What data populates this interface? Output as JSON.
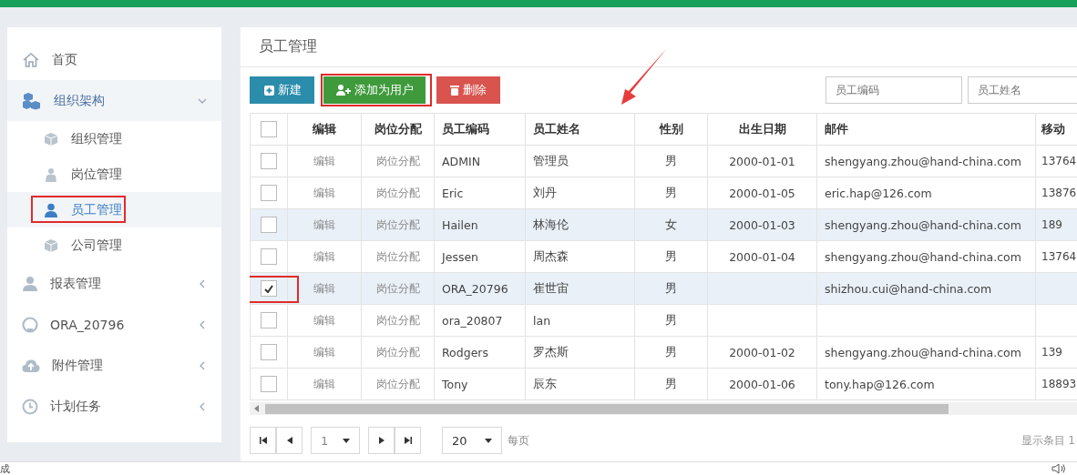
{
  "sidebar": {
    "items": [
      {
        "label": "首页",
        "kind": "link"
      },
      {
        "label": "组织架构",
        "kind": "group",
        "expanded": true,
        "children": [
          {
            "label": "组织管理",
            "selected": false
          },
          {
            "label": "岗位管理",
            "selected": false
          },
          {
            "label": "员工管理",
            "selected": true
          },
          {
            "label": "公司管理",
            "selected": false
          }
        ]
      },
      {
        "label": "报表管理",
        "kind": "group",
        "expanded": false
      },
      {
        "label": "ORA_20796",
        "kind": "group",
        "expanded": false
      },
      {
        "label": "附件管理",
        "kind": "group",
        "expanded": false
      },
      {
        "label": "计划任务",
        "kind": "group",
        "expanded": false
      }
    ]
  },
  "page_title": "员工管理",
  "toolbar": {
    "buttons": [
      {
        "label": "新建",
        "kind": "new"
      },
      {
        "label": "添加为用户",
        "kind": "add-user"
      },
      {
        "label": "删除",
        "kind": "delete"
      }
    ],
    "filters": [
      {
        "placeholder": "员工编码"
      },
      {
        "placeholder": "员工姓名"
      }
    ]
  },
  "table": {
    "select_all_checked": false,
    "columns": [
      "编辑",
      "岗位分配",
      "员工编码",
      "员工姓名",
      "性别",
      "出生日期",
      "邮件",
      "移动"
    ],
    "rows": [
      {
        "checked": false,
        "highlighted": false,
        "edit": "编辑",
        "assign": "岗位分配",
        "code": "ADMIN",
        "name": "管理员",
        "gender": "男",
        "birth": "2000-01-01",
        "email": "shengyang.zhou@hand-china.com",
        "phone": "13764"
      },
      {
        "checked": false,
        "highlighted": false,
        "edit": "编辑",
        "assign": "岗位分配",
        "code": "Eric",
        "name": "刘丹",
        "gender": "男",
        "birth": "2000-01-05",
        "email": "eric.hap@126.com",
        "phone": "13876"
      },
      {
        "checked": false,
        "highlighted": true,
        "edit": "编辑",
        "assign": "岗位分配",
        "code": "Hailen",
        "name": "林海伦",
        "gender": "女",
        "birth": "2000-01-03",
        "email": "shengyang.zhou@hand-china.com",
        "phone": "189"
      },
      {
        "checked": false,
        "highlighted": false,
        "edit": "编辑",
        "assign": "岗位分配",
        "code": "Jessen",
        "name": "周杰森",
        "gender": "男",
        "birth": "2000-01-04",
        "email": "shengyang.zhou@hand-china.com",
        "phone": "13764"
      },
      {
        "checked": true,
        "highlighted": true,
        "edit": "编辑",
        "assign": "岗位分配",
        "code": "ORA_20796",
        "name": "崔世宙",
        "gender": "男",
        "email": "shizhou.cui@hand-china.com"
      },
      {
        "checked": false,
        "highlighted": false,
        "edit": "编辑",
        "assign": "岗位分配",
        "code": "ora_20807",
        "name": "lan",
        "gender": "男"
      },
      {
        "checked": false,
        "highlighted": false,
        "edit": "编辑",
        "assign": "岗位分配",
        "code": "Rodgers",
        "name": "罗杰斯",
        "gender": "男",
        "birth": "2000-01-02",
        "email": "shengyang.zhou@hand-china.com",
        "phone": "139"
      },
      {
        "checked": false,
        "highlighted": false,
        "edit": "编辑",
        "assign": "岗位分配",
        "code": "Tony",
        "name": "辰东",
        "gender": "男",
        "birth": "2000-01-06",
        "email": "tony.hap@126.com",
        "phone": "18893"
      }
    ]
  },
  "pager": {
    "page": "1",
    "page_size": "20",
    "per_page_label": "每页",
    "summary": "显示条目 1"
  },
  "status_bar": {
    "text": "成"
  }
}
